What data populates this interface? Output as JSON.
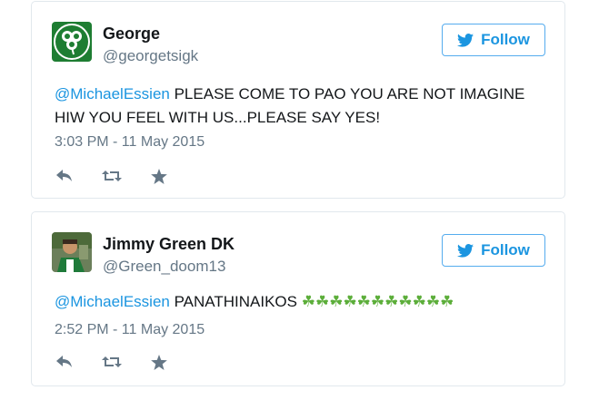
{
  "tweets": [
    {
      "name": "George",
      "handle": "@georgetsigk",
      "follow_label": "Follow",
      "mention": "@MichaelEssien",
      "text": " PLEASE COME TO PAO YOU ARE NOT IMAGINE HIW YOU FEEL WITH US...PLEASE SAY YES!",
      "timestamp": "3:03 PM - 11 May 2015",
      "avatar_icon": "shamrock-logo-icon"
    },
    {
      "name": "Jimmy Green DK",
      "handle": "@Green_doom13",
      "follow_label": "Follow",
      "mention": "@MichaelEssien",
      "text": " PANATHINAIKOS ",
      "emoji": "☘☘☘☘☘☘☘☘☘☘☘",
      "timestamp": "2:52 PM - 11 May 2015",
      "avatar_icon": "user-photo"
    }
  ],
  "icons": {
    "follow": "twitter-bird-icon",
    "reply": "reply-icon",
    "retweet": "retweet-icon",
    "favorite": "star-icon"
  },
  "colors": {
    "link": "#1b95e0",
    "follow_border": "#55acee",
    "muted": "#657786",
    "border": "#e1e8ed",
    "avatar_green": "#1e7d32",
    "clover": "#5cae3a"
  }
}
